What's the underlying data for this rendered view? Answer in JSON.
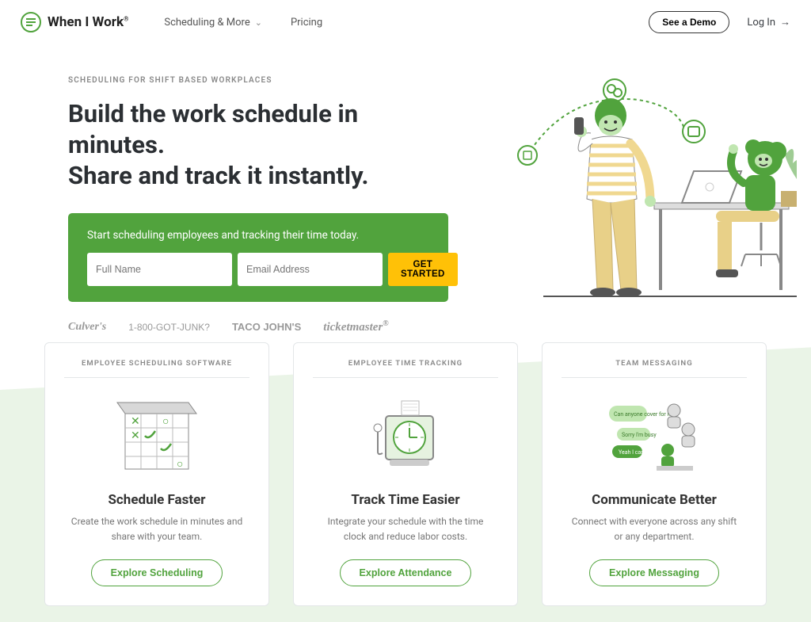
{
  "header": {
    "brand": "When I Work",
    "nav": [
      {
        "label": "Scheduling & More"
      },
      {
        "label": "Pricing"
      }
    ],
    "demo_button": "See a Demo",
    "login": "Log In"
  },
  "hero": {
    "eyebrow": "SCHEDULING FOR SHIFT BASED WORKPLACES",
    "headline_1": "Build the work schedule in minutes.",
    "headline_2": "Share and track it instantly.",
    "signup": {
      "prompt": "Start scheduling employees and tracking their time today.",
      "name_placeholder": "Full Name",
      "email_placeholder": "Email Address",
      "button": "GET STARTED"
    },
    "brands": [
      "Culver's",
      "1-800-GOT-JUNK?",
      "TACO JOHN'S",
      "ticketmaster"
    ]
  },
  "features": [
    {
      "eyebrow": "EMPLOYEE SCHEDULING SOFTWARE",
      "title": "Schedule Faster",
      "desc": "Create the work schedule in minutes and share with your team.",
      "cta": "Explore Scheduling"
    },
    {
      "eyebrow": "EMPLOYEE TIME TRACKING",
      "title": "Track Time Easier",
      "desc": "Integrate your schedule with the time clock and reduce labor costs.",
      "cta": "Explore Attendance"
    },
    {
      "eyebrow": "TEAM MESSAGING",
      "title": "Communicate Better",
      "desc": "Connect with everyone across any shift or any department.",
      "cta": "Explore Messaging"
    }
  ]
}
